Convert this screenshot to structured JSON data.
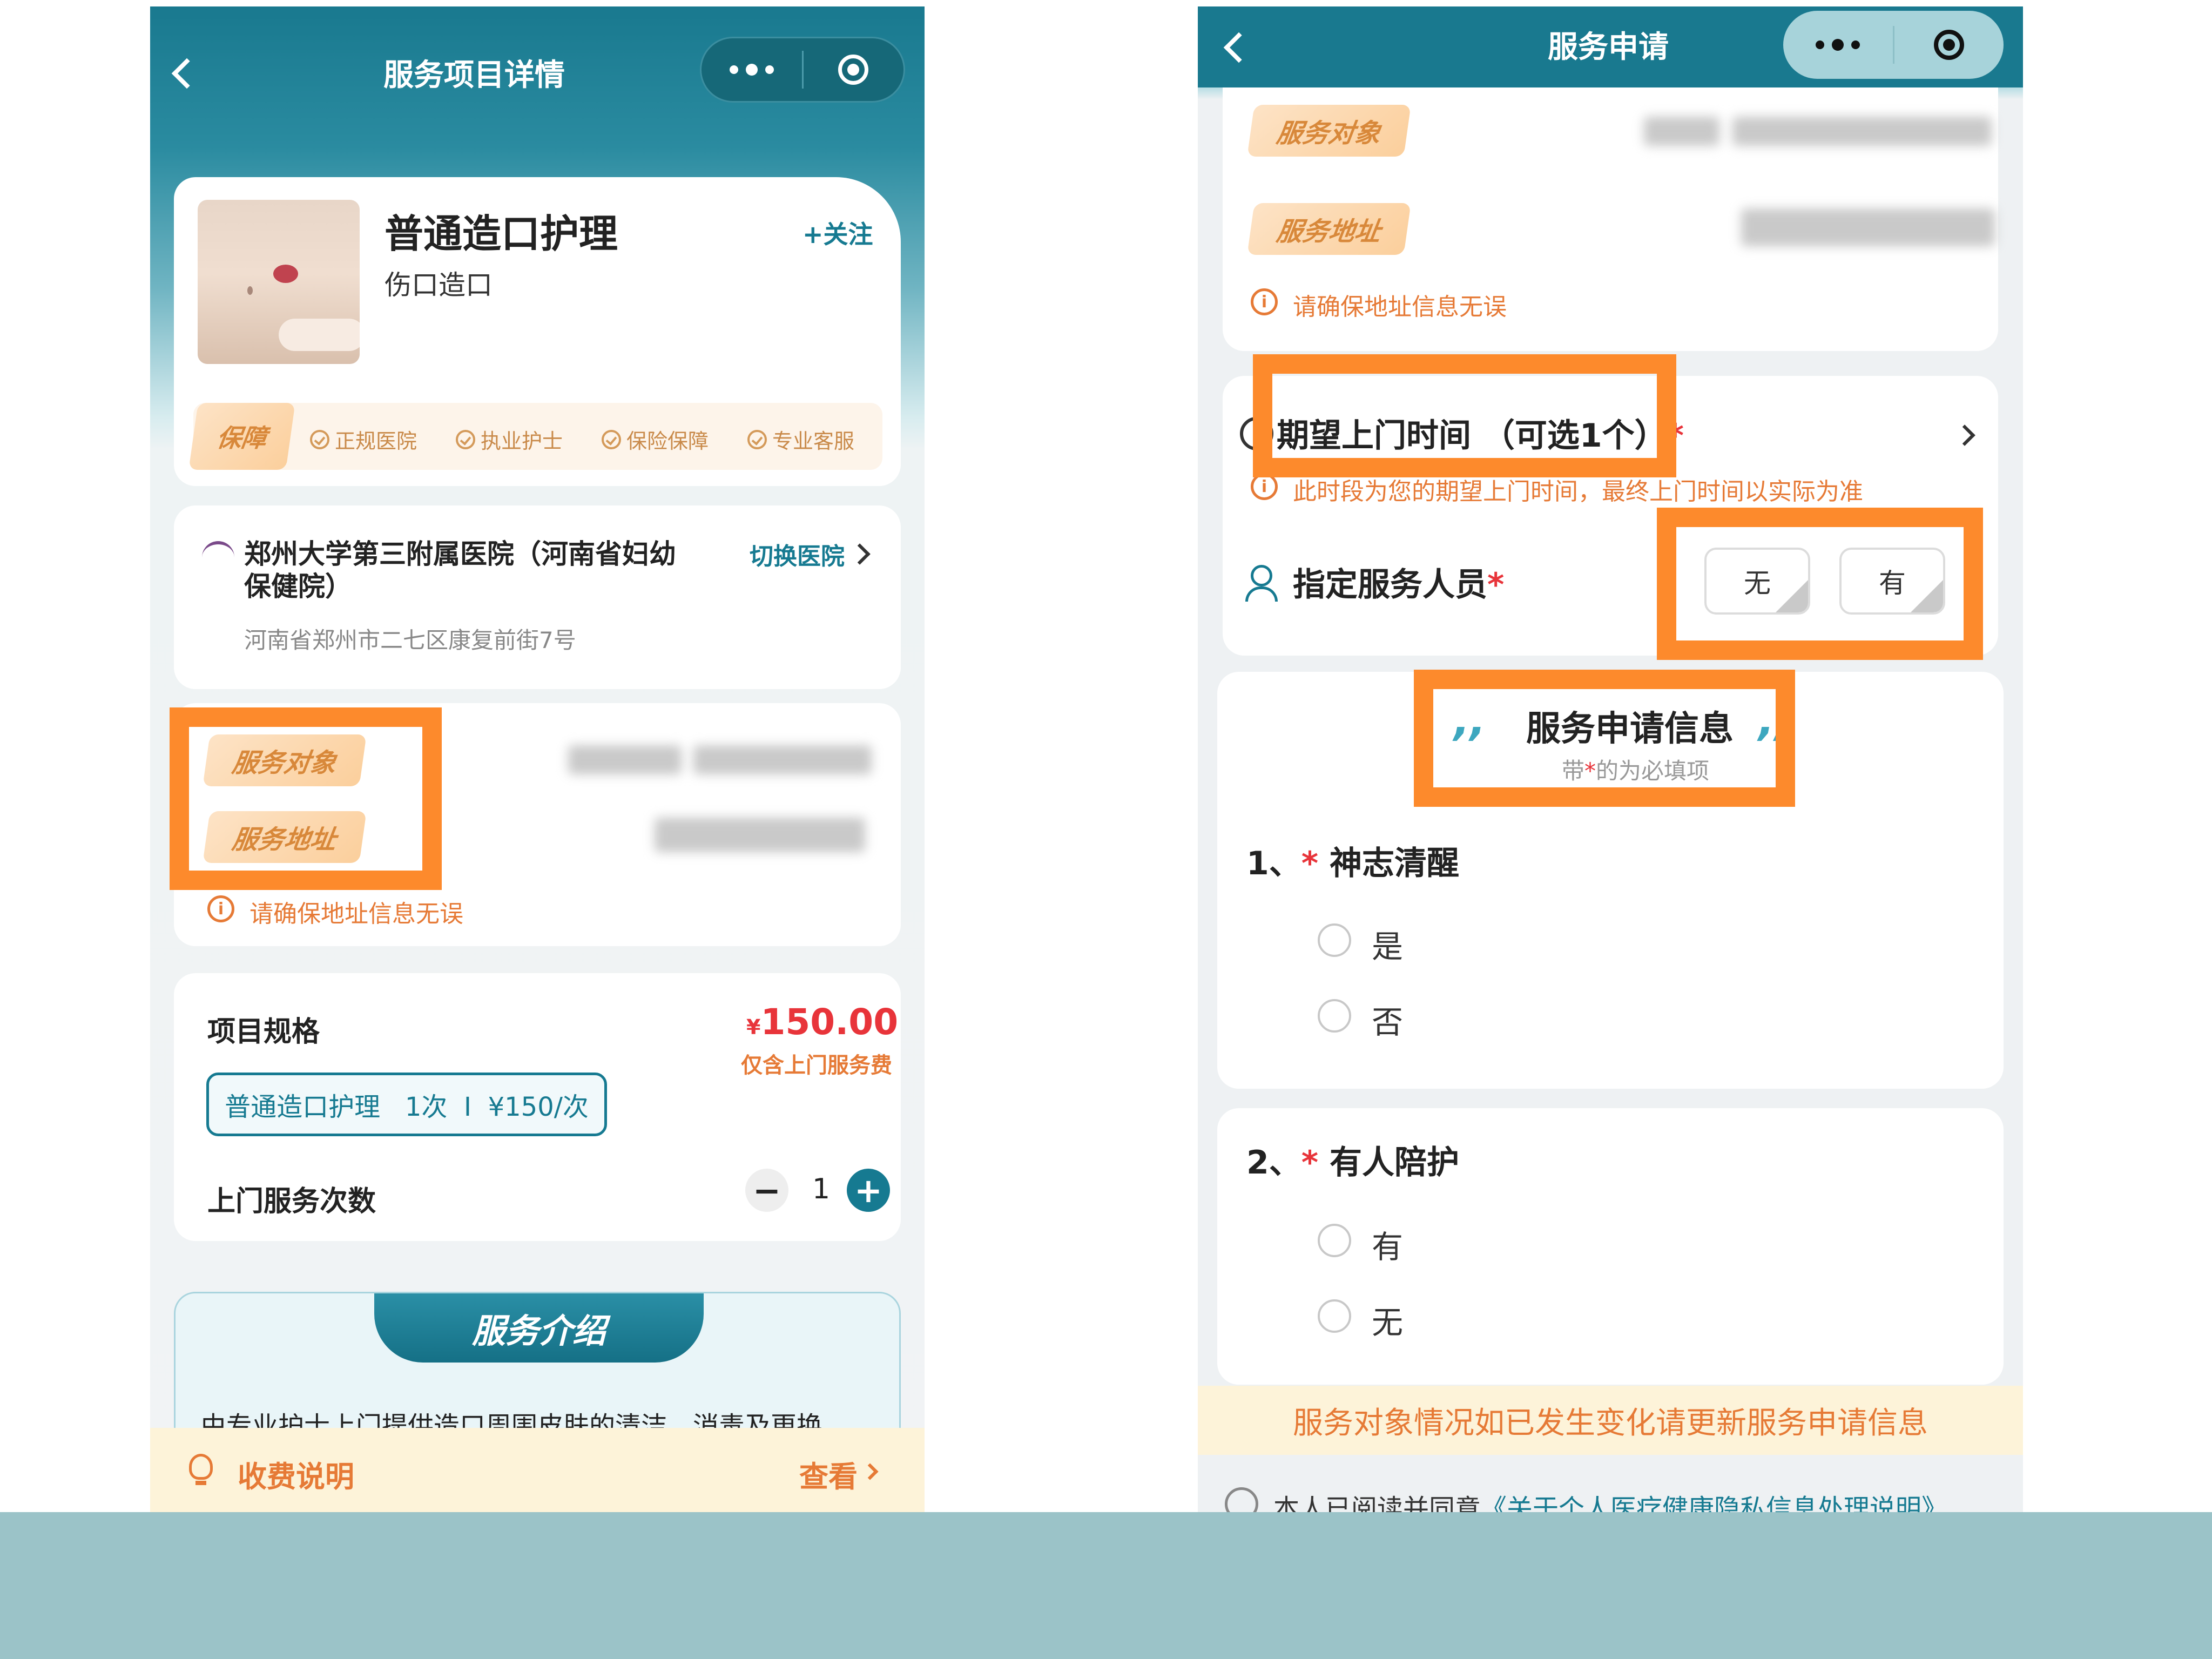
{
  "left": {
    "nav_title": "服务项目详情",
    "product": {
      "name": "普通造口护理",
      "subtitle": "伤口造口",
      "follow_label": "+关注"
    },
    "guarantee": {
      "badge": "保障",
      "items": [
        "正规医院",
        "执业护士",
        "保险保障",
        "专业客服"
      ]
    },
    "hospital": {
      "name_line1": "郑州大学第三附属医院（河南省妇幼",
      "name_line2": "保健院）",
      "address": "河南省郑州市二七区康复前街7号",
      "switch_label": "切换医院"
    },
    "service_target_label": "服务对象",
    "service_address_label": "服务地址",
    "address_notice": "请确保地址信息无误",
    "spec": {
      "title": "项目规格",
      "price_symbol": "¥",
      "price": "150.00",
      "price_note": "仅含上门服务费",
      "option": "普通造口护理   1次  I  ¥150/次",
      "count_label": "上门服务次数",
      "count": "1",
      "minus": "−",
      "plus": "+"
    },
    "intro": {
      "tab": "服务介绍",
      "text": "由专业护士上门提供造口周围皮肤的清洁、消毒及更换"
    },
    "fee": {
      "label": "收费说明",
      "view": "查看"
    }
  },
  "right": {
    "nav_title": "服务申请",
    "service_target_label": "服务对象",
    "service_address_label": "服务地址",
    "address_notice": "请确保地址信息无误",
    "time": {
      "label": "期望上门时间 （可选1个）",
      "star": "*",
      "note": "此时段为您的期望上门时间，最终上门时间以实际为准"
    },
    "staff": {
      "label": "指定服务人员",
      "star": "*",
      "opt_none": "无",
      "opt_yes": "有"
    },
    "info": {
      "title": "服务申请信息",
      "sub_prefix": "带",
      "sub_star": "*",
      "sub_suffix": "的为必填项"
    },
    "questions": [
      {
        "num": "1、",
        "star": "*",
        "title": "神志清醒",
        "options": [
          "是",
          "否"
        ]
      },
      {
        "num": "2、",
        "star": "*",
        "title": "有人陪护",
        "options": [
          "有",
          "无"
        ]
      }
    ],
    "notice": "服务对象情况如已发生变化请更新服务申请信息",
    "agree": {
      "prefix": "本人已阅读并同意",
      "link": "《关于个人医疗健康隐私信息处理说明》"
    }
  },
  "colors": {
    "teal": "#19798f",
    "highlight": "#fd8a2c",
    "price_red": "#e8343a",
    "orange_text": "#e67a36"
  }
}
